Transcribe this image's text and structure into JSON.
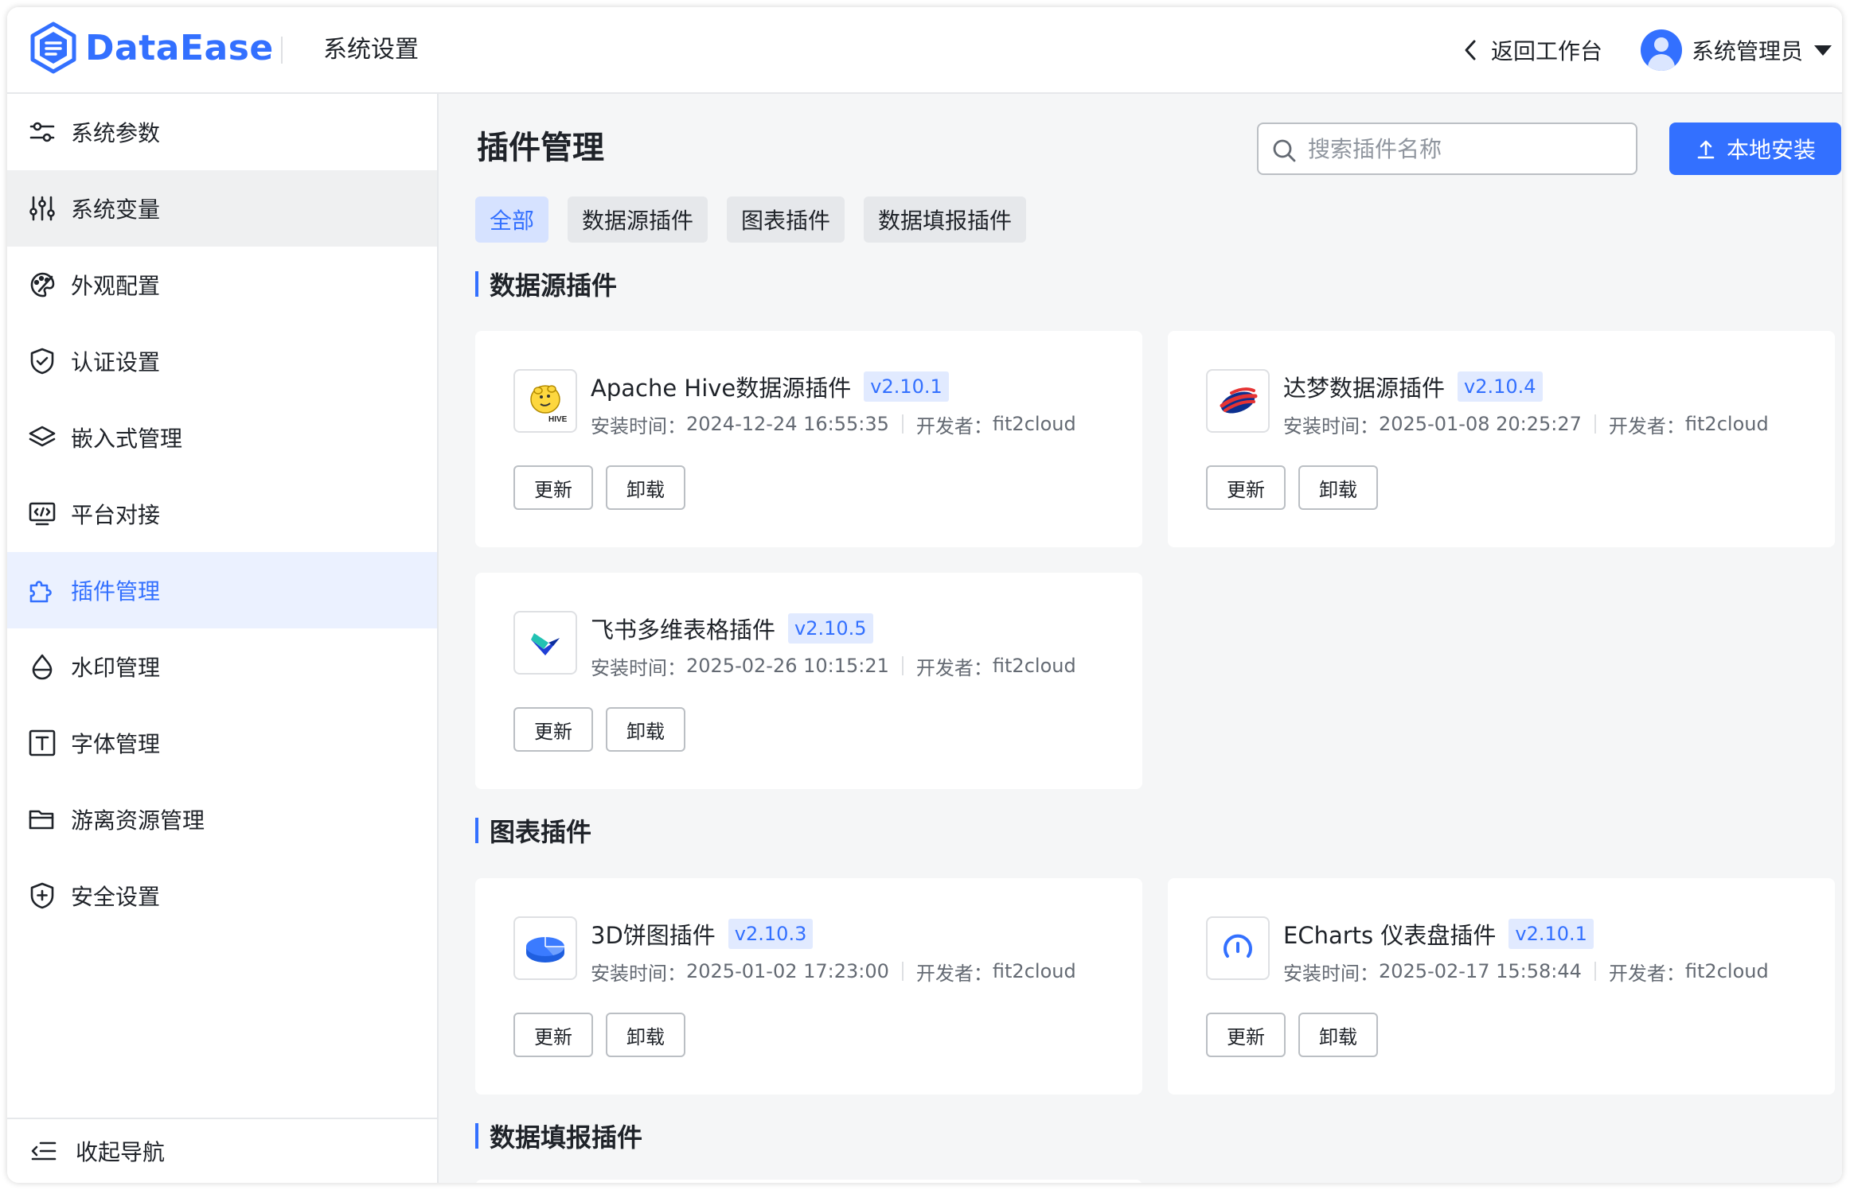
{
  "header": {
    "logo_text": "DataEase",
    "title": "系统设置",
    "back_label": "返回工作台",
    "user_name": "系统管理员"
  },
  "sidebar": {
    "items": [
      {
        "label": "系统参数",
        "icon": "sliders-icon"
      },
      {
        "label": "系统变量",
        "icon": "variable-icon"
      },
      {
        "label": "外观配置",
        "icon": "palette-icon"
      },
      {
        "label": "认证设置",
        "icon": "shield-check-icon"
      },
      {
        "label": "嵌入式管理",
        "icon": "layers-icon"
      },
      {
        "label": "平台对接",
        "icon": "monitor-code-icon"
      },
      {
        "label": "插件管理",
        "icon": "puzzle-icon"
      },
      {
        "label": "水印管理",
        "icon": "drop-icon"
      },
      {
        "label": "字体管理",
        "icon": "font-icon"
      },
      {
        "label": "游离资源管理",
        "icon": "folder-icon"
      },
      {
        "label": "安全设置",
        "icon": "shield-plus-icon"
      }
    ],
    "active_index": 6,
    "hover_index": 1,
    "collapse_label": "收起导航"
  },
  "main": {
    "title": "插件管理",
    "search_placeholder": "搜索插件名称",
    "install_label": "本地安装",
    "tabs": [
      "全部",
      "数据源插件",
      "图表插件",
      "数据填报插件"
    ],
    "active_tab": 0,
    "sections": [
      {
        "title": "数据源插件",
        "plugins": [
          {
            "name": "Apache Hive数据源插件",
            "version": "v2.10.1",
            "install_label": "安装时间：",
            "install_time": "2024-12-24 16:55:35",
            "developer_label": "开发者：",
            "developer": "fit2cloud",
            "logo": "hive-logo"
          },
          {
            "name": "达梦数据源插件",
            "version": "v2.10.4",
            "install_label": "安装时间：",
            "install_time": "2025-01-08 20:25:27",
            "developer_label": "开发者：",
            "developer": "fit2cloud",
            "logo": "dameng-logo"
          },
          {
            "name": "飞书多维表格插件",
            "version": "v2.10.5",
            "install_label": "安装时间：",
            "install_time": "2025-02-26 10:15:21",
            "developer_label": "开发者：",
            "developer": "fit2cloud",
            "logo": "feishu-logo"
          }
        ]
      },
      {
        "title": "图表插件",
        "plugins": [
          {
            "name": "3D饼图插件",
            "version": "v2.10.3",
            "install_label": "安装时间：",
            "install_time": "2025-01-02 17:23:00",
            "developer_label": "开发者：",
            "developer": "fit2cloud",
            "logo": "pie3d-logo"
          },
          {
            "name": "ECharts 仪表盘插件",
            "version": "v2.10.1",
            "install_label": "安装时间：",
            "install_time": "2025-02-17 15:58:44",
            "developer_label": "开发者：",
            "developer": "fit2cloud",
            "logo": "gauge-logo"
          }
        ]
      },
      {
        "title": "数据填报插件",
        "plugins": []
      }
    ],
    "update_label": "更新",
    "uninstall_label": "卸载"
  },
  "colors": {
    "primary": "#3370ff",
    "active_bg": "#ebf1ff",
    "main_bg": "#f5f6f7",
    "version_bg": "#e1eaff"
  }
}
